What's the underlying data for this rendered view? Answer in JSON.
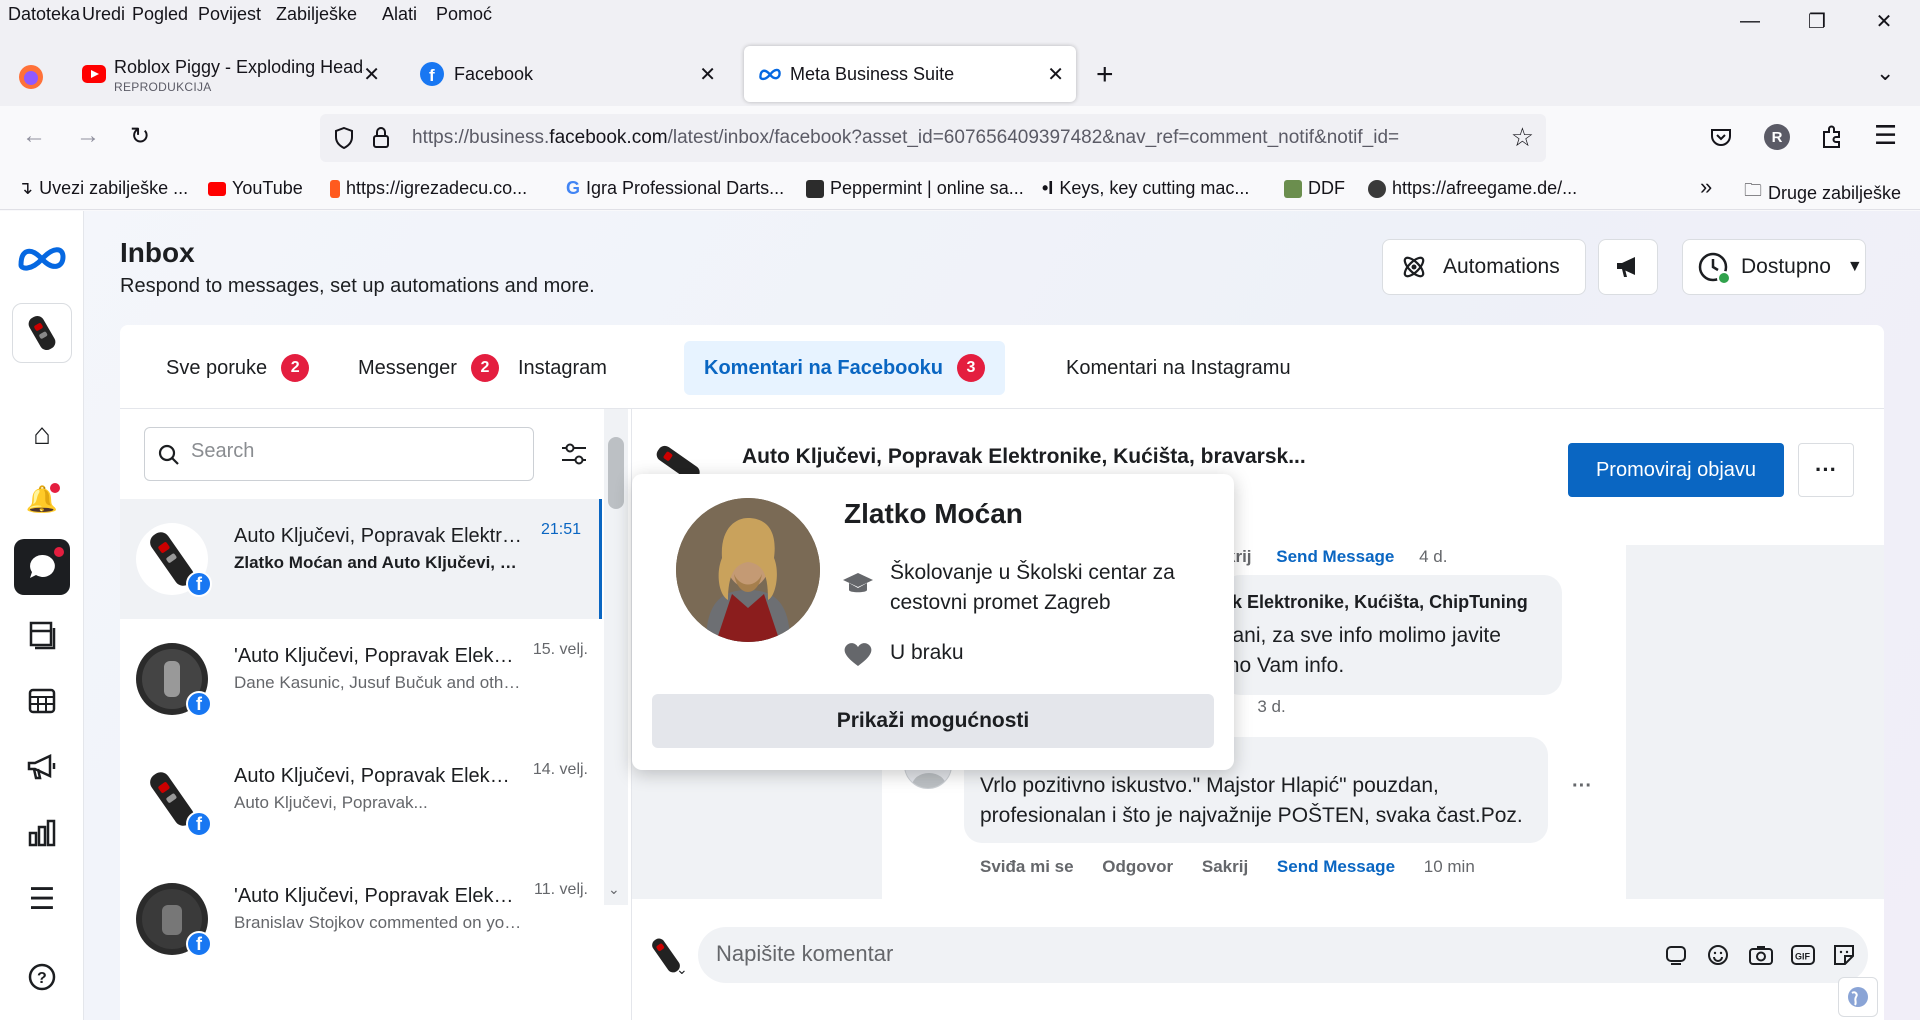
{
  "menu": [
    "Datoteka",
    "Uredi",
    "Pogled",
    "Povijest",
    "Zabilješke",
    "Alati",
    "Pomoć"
  ],
  "tabs": [
    {
      "title": "Roblox Piggy - Exploding Heads",
      "subtitle": "REPRODUKCIJA"
    },
    {
      "title": "Facebook"
    },
    {
      "title": "Meta Business Suite"
    }
  ],
  "url": {
    "prefix": "https://business.",
    "domain": "facebook.com",
    "path": "/latest/inbox/facebook?asset_id=607656409397482&nav_ref=comment_notif&notif_id="
  },
  "bookmarks": [
    "Uvezi zabilješke ...",
    "YouTube",
    "https://igrezadecu.co...",
    "Igra Professional Darts...",
    "Peppermint | online sa...",
    "Keys, key cutting mac...",
    "DDF",
    "https://afreegame.de/...",
    "Druge zabilješke"
  ],
  "header": {
    "title": "Inbox",
    "subtitle": "Respond to messages, set up automations and more.",
    "automations": "Automations",
    "status": "Dostupno"
  },
  "inbox_tabs": [
    {
      "label": "Sve poruke",
      "count": "2"
    },
    {
      "label": "Messenger",
      "count": "2"
    },
    {
      "label": "Instagram"
    },
    {
      "label": "Komentari na Facebooku",
      "count": "3"
    },
    {
      "label": "Komentari na Instagramu"
    }
  ],
  "search": {
    "placeholder": "Search"
  },
  "conversations": [
    {
      "title": "Auto Ključevi, Popravak Elektronike",
      "preview": "Zlatko Moćan and Auto Ključevi, Popravak",
      "time": "21:51"
    },
    {
      "title": "'Auto Ključevi, Popravak Elektronike",
      "preview": "Dane Kasunic, Jusuf Bučuk and others",
      "time": "15. velj."
    },
    {
      "title": "Auto Ključevi, Popravak Elektronike",
      "preview": "Auto Ključevi, Popravak...",
      "time": "14. velj."
    },
    {
      "title": "'Auto Ključevi, Popravak Elektronike",
      "preview": "Branislav Stojkov commented on your post",
      "time": "11. velj."
    }
  ],
  "post": {
    "page_title": "Auto Ključevi, Popravak Elektronike, Kućišta, bravarsk...",
    "promote": "Promoviraj objavu"
  },
  "comments": {
    "top_actions": {
      "hide": "krij",
      "send": "Send Message",
      "time": "4 d."
    },
    "reply": {
      "author": "ak Elektronike, Kućišta, ChipTuning",
      "lines": [
        "vani, za sve info molimo javite",
        "mo Vam info."
      ],
      "actions_tail": "r",
      "time": "3 d."
    },
    "last": {
      "author": "Zlatko Moćan",
      "text": "Vrlo pozitivno iskustvo.\" Majstor Hlapić\" pouzdan, profesionalan i što je najvažnije POŠTEN, svaka čast.Poz.",
      "like": "Sviđa mi se",
      "reply": "Odgovor",
      "hide": "Sakrij",
      "send": "Send Message",
      "time": "10 min"
    }
  },
  "composer": {
    "placeholder": "Napišite komentar"
  },
  "profile_popover": {
    "name": "Zlatko Moćan",
    "education": "Školovanje u Školski centar za cestovni promet Zagreb",
    "relationship": "U braku",
    "button": "Prikaži mogućnosti"
  },
  "colors": {
    "accent": "#0a66c2",
    "badge": "#e41e3f",
    "facebook": "#1877f2"
  }
}
